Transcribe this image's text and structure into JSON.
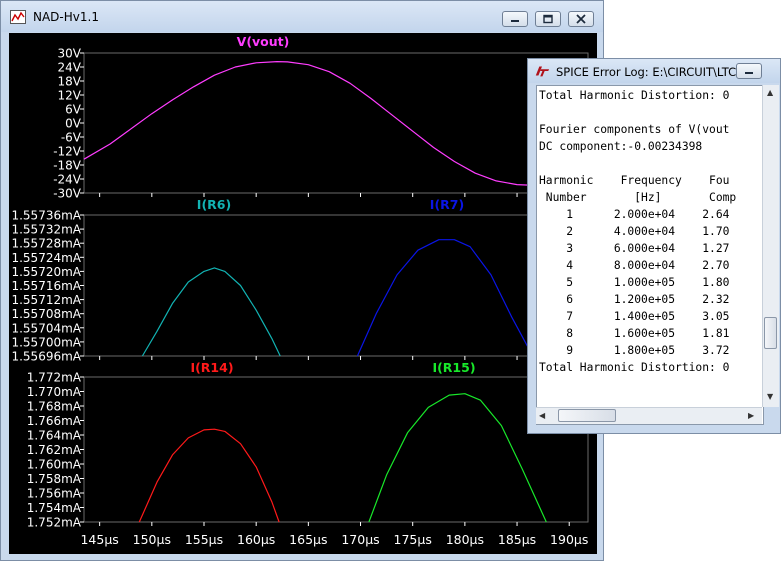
{
  "main_window": {
    "title": "NAD-Hv1.1",
    "buttons": [
      "minimize",
      "restore",
      "close"
    ]
  },
  "error_window": {
    "title": "SPICE Error Log: E:\\CIRCUIT\\LTC...",
    "lines": [
      "Total Harmonic Distortion: 0",
      "",
      "Fourier components of V(vout",
      "DC component:-0.00234398",
      "",
      "Harmonic    Frequency    Fou",
      " Number       [Hz]       Comp",
      "    1      2.000e+04    2.64",
      "    2      4.000e+04    1.70",
      "    3      6.000e+04    1.27",
      "    4      8.000e+04    2.70",
      "    5      1.000e+05    1.80",
      "    6      1.200e+05    2.32",
      "    7      1.400e+05    3.05",
      "    8      1.600e+05    1.81",
      "    9      1.800e+05    3.72",
      "Total Harmonic Distortion: 0",
      ""
    ]
  },
  "chart_data": {
    "type": "line",
    "x_ticks": [
      "145µs",
      "150µs",
      "155µs",
      "160µs",
      "165µs",
      "170µs",
      "175µs",
      "180µs",
      "185µs",
      "190µs"
    ],
    "xlim": [
      143.5,
      191.8
    ],
    "colors": {
      "vout": "#ff3dff",
      "R6": "#0a15e6",
      "R7": "#12b3b3",
      "R14": "#ff1a1a",
      "R15": "#18e82a",
      "axis_text": "#ffffff",
      "grid": "#6a6a6a"
    },
    "panes": [
      {
        "series_labels": [
          "V(vout)"
        ],
        "y_ticks": [
          "30V",
          "24V",
          "18V",
          "12V",
          "6V",
          "0V",
          "-6V",
          "-12V",
          "-18V",
          "-24V",
          "-30V"
        ],
        "ylim": [
          -30,
          30
        ],
        "series": [
          {
            "name": "V(vout)",
            "color_key": "vout",
            "points": [
              [
                143.5,
                -15.5
              ],
              [
                146,
                -9
              ],
              [
                148,
                -2.5
              ],
              [
                150,
                4
              ],
              [
                152,
                10
              ],
              [
                154,
                15.5
              ],
              [
                156,
                20.5
              ],
              [
                158,
                24
              ],
              [
                160,
                25.8
              ],
              [
                162,
                26.3
              ],
              [
                163,
                26.2
              ],
              [
                165,
                25
              ],
              [
                167,
                22
              ],
              [
                169,
                17
              ],
              [
                171,
                10.5
              ],
              [
                173,
                3.5
              ],
              [
                175,
                -3.5
              ],
              [
                177,
                -10.5
              ],
              [
                179,
                -16.5
              ],
              [
                181,
                -21.5
              ],
              [
                183,
                -24.8
              ],
              [
                185,
                -26.4
              ],
              [
                187,
                -26.8
              ],
              [
                189,
                -26
              ],
              [
                190.5,
                -25
              ]
            ]
          }
        ]
      },
      {
        "series_labels": [
          "I(R6)",
          "I(R7)"
        ],
        "y_ticks": [
          "1.55736mA",
          "1.55732mA",
          "1.55728mA",
          "1.55724mA",
          "1.55720mA",
          "1.55716mA",
          "1.55712mA",
          "1.55708mA",
          "1.55704mA",
          "1.55700mA",
          "1.55696mA"
        ],
        "ylim": [
          1.55696,
          1.55736
        ],
        "series": [
          {
            "name": "I(R6)",
            "color_key": "R7",
            "points": [
              [
                149.1,
                1.55696
              ],
              [
                150.5,
                1.55703
              ],
              [
                152,
                1.55711
              ],
              [
                153.5,
                1.55717
              ],
              [
                155,
                1.5572
              ],
              [
                156,
                1.55721
              ],
              [
                157,
                1.5572
              ],
              [
                158.5,
                1.55716
              ],
              [
                160,
                1.55709
              ],
              [
                161.5,
                1.55701
              ],
              [
                162.3,
                1.55696
              ]
            ]
          },
          {
            "name": "I(R7)",
            "color_key": "R6",
            "points": [
              [
                169.7,
                1.55696
              ],
              [
                171.5,
                1.55708
              ],
              [
                173.5,
                1.55719
              ],
              [
                175.5,
                1.55726
              ],
              [
                177.5,
                1.55729
              ],
              [
                179,
                1.55729
              ],
              [
                180.5,
                1.55727
              ],
              [
                182.5,
                1.55719
              ],
              [
                184.5,
                1.55707
              ],
              [
                186.5,
                1.55696
              ]
            ]
          }
        ]
      },
      {
        "series_labels": [
          "I(R14)",
          "I(R15)"
        ],
        "y_ticks": [
          "1.772mA",
          "1.770mA",
          "1.768mA",
          "1.766mA",
          "1.764mA",
          "1.762mA",
          "1.760mA",
          "1.758mA",
          "1.756mA",
          "1.754mA",
          "1.752mA"
        ],
        "ylim": [
          1.752,
          1.772
        ],
        "series": [
          {
            "name": "I(R14)",
            "color_key": "R14",
            "points": [
              [
                148.8,
                1.752
              ],
              [
                150.5,
                1.7575
              ],
              [
                152,
                1.7613
              ],
              [
                153.5,
                1.7636
              ],
              [
                155,
                1.7647
              ],
              [
                156,
                1.7648
              ],
              [
                157,
                1.7645
              ],
              [
                158.5,
                1.7628
              ],
              [
                160,
                1.7596
              ],
              [
                161.5,
                1.7548
              ],
              [
                162.2,
                1.752
              ]
            ]
          },
          {
            "name": "I(R15)",
            "color_key": "R15",
            "points": [
              [
                170.8,
                1.752
              ],
              [
                172.5,
                1.7585
              ],
              [
                174.5,
                1.7643
              ],
              [
                176.5,
                1.7678
              ],
              [
                178.5,
                1.7695
              ],
              [
                180,
                1.7697
              ],
              [
                181.5,
                1.7688
              ],
              [
                183.5,
                1.7653
              ],
              [
                185.5,
                1.7593
              ],
              [
                187.8,
                1.752
              ]
            ]
          }
        ]
      }
    ]
  }
}
